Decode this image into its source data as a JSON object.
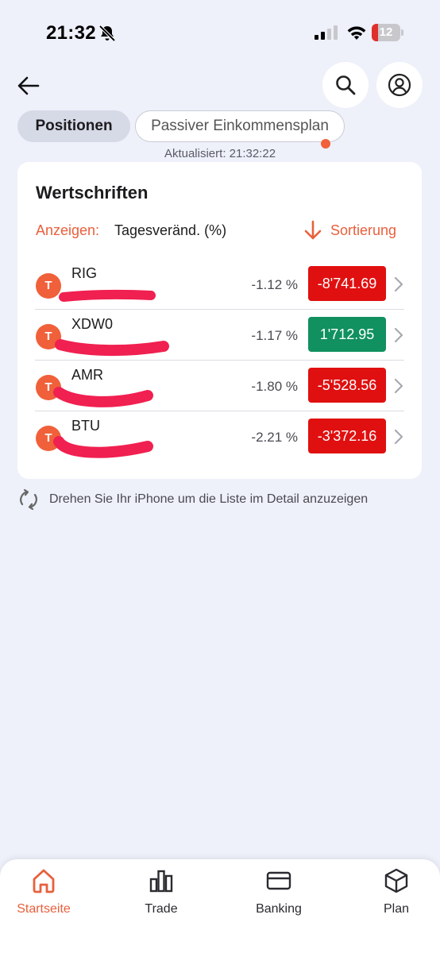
{
  "status_bar": {
    "time": "21:32",
    "battery": "12"
  },
  "header": {
    "back_label": "",
    "search_label": "",
    "profile_label": ""
  },
  "tabs": [
    {
      "label": "Positionen",
      "active": true
    },
    {
      "label": "Passiver Einkommensplan",
      "active": false
    }
  ],
  "updated_text": "Aktualisiert: 21:32:22",
  "card": {
    "title": "Wertschriften",
    "filter_label": "Anzeigen:",
    "filter_value": "Tagesveränd. (%)",
    "sort_label": "Sortierung"
  },
  "positions": [
    {
      "icon_letter": "T",
      "symbol": "RIG",
      "change_pct": "-1.12 %",
      "value": "-8'741.69",
      "trend": "down"
    },
    {
      "icon_letter": "T",
      "symbol": "XDW0",
      "change_pct": "-1.17 %",
      "value": "1'712.95",
      "trend": "up"
    },
    {
      "icon_letter": "T",
      "symbol": "AMR",
      "change_pct": "-1.80 %",
      "value": "-5'528.56",
      "trend": "down"
    },
    {
      "icon_letter": "T",
      "symbol": "BTU",
      "change_pct": "-2.21 %",
      "value": "-3'372.16",
      "trend": "down"
    }
  ],
  "hint": "Drehen Sie Ihr iPhone um die Liste im Detail anzuzeigen",
  "nav": [
    {
      "label": "Startseite",
      "icon": "home-icon",
      "active": true
    },
    {
      "label": "Trade",
      "icon": "bar-chart-icon",
      "active": false
    },
    {
      "label": "Banking",
      "icon": "card-icon",
      "active": false
    },
    {
      "label": "Plan",
      "icon": "cube-icon",
      "active": false
    }
  ],
  "colors": {
    "accent": "#e8603c",
    "negative": "#e01010",
    "positive": "#119060",
    "background": "#eef0fa"
  }
}
